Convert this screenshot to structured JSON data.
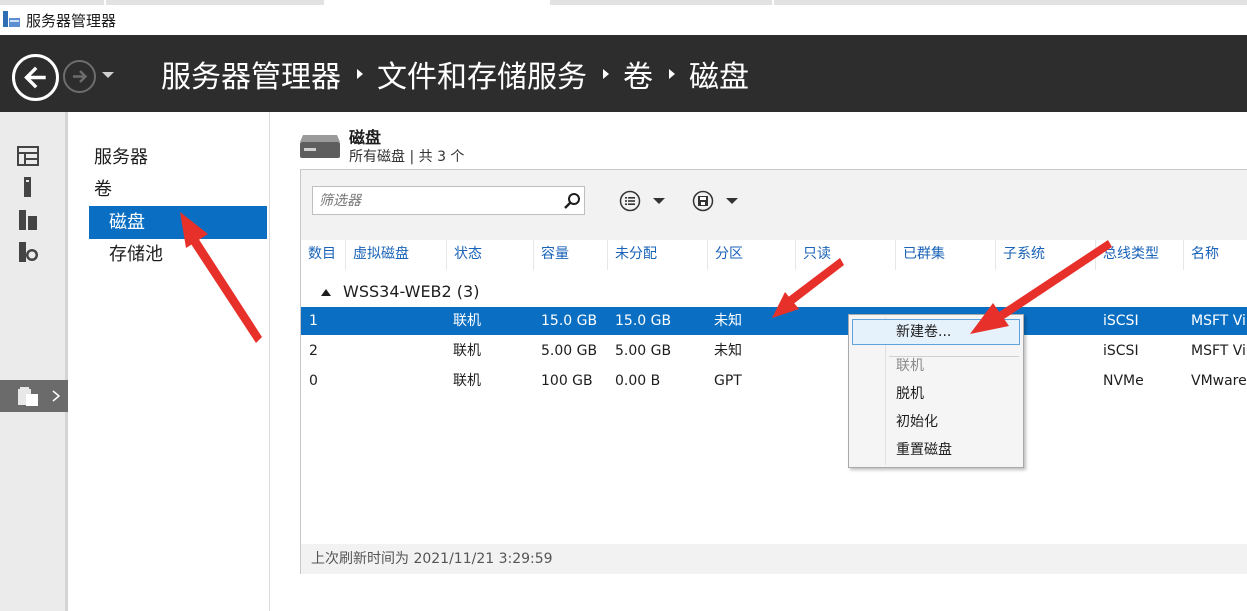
{
  "window": {
    "title": "服务器管理器"
  },
  "header": {
    "breadcrumb": [
      "服务器管理器",
      "文件和存储服务",
      "卷",
      "磁盘"
    ]
  },
  "nav": {
    "items": [
      "服务器",
      "卷",
      "磁盘",
      "存储池"
    ],
    "selected": "磁盘"
  },
  "section": {
    "title": "磁盘",
    "subtitle": "所有磁盘 | 共 3 个"
  },
  "toolbar": {
    "filter_placeholder": "筛选器"
  },
  "table": {
    "columns": [
      "数目",
      "虚拟磁盘",
      "状态",
      "容量",
      "未分配",
      "分区",
      "只读",
      "已群集",
      "子系统",
      "总线类型",
      "名称"
    ],
    "group": "WSS34-WEB2 (3)",
    "rows": [
      {
        "number": "1",
        "virtual_disk": "",
        "status": "联机",
        "capacity": "15.0 GB",
        "unallocated": "15.0 GB",
        "partition": "未知",
        "bus": "iSCSI",
        "name": "MSFT Vi",
        "selected": true
      },
      {
        "number": "2",
        "virtual_disk": "",
        "status": "联机",
        "capacity": "5.00 GB",
        "unallocated": "5.00 GB",
        "partition": "未知",
        "bus": "iSCSI",
        "name": "MSFT Vi",
        "selected": false
      },
      {
        "number": "0",
        "virtual_disk": "",
        "status": "联机",
        "capacity": "100 GB",
        "unallocated": "0.00 B",
        "partition": "GPT",
        "bus": "NVMe",
        "name": "VMware",
        "selected": false
      }
    ],
    "footer": "上次刷新时间为 2021/11/21 3:29:59"
  },
  "context_menu": {
    "items": [
      {
        "label": "新建卷...",
        "state": "hover"
      },
      {
        "label": "联机",
        "state": "disabled"
      },
      {
        "label": "脱机",
        "state": "normal"
      },
      {
        "label": "初始化",
        "state": "normal"
      },
      {
        "label": "重置磁盘",
        "state": "normal"
      }
    ]
  },
  "colors": {
    "header_bg": "#2d2d2d",
    "selection": "#0a6fc3",
    "column_header_text": "#1a63b8",
    "annotation_arrow": "#e8302a"
  },
  "icons": {
    "rail": [
      "dashboard-icon",
      "local-server-icon",
      "all-servers-icon",
      "iis-icon",
      "file-storage-icon"
    ],
    "section": "disk-icon",
    "toolbar": [
      "task-list-icon",
      "disk-task-icon"
    ]
  }
}
